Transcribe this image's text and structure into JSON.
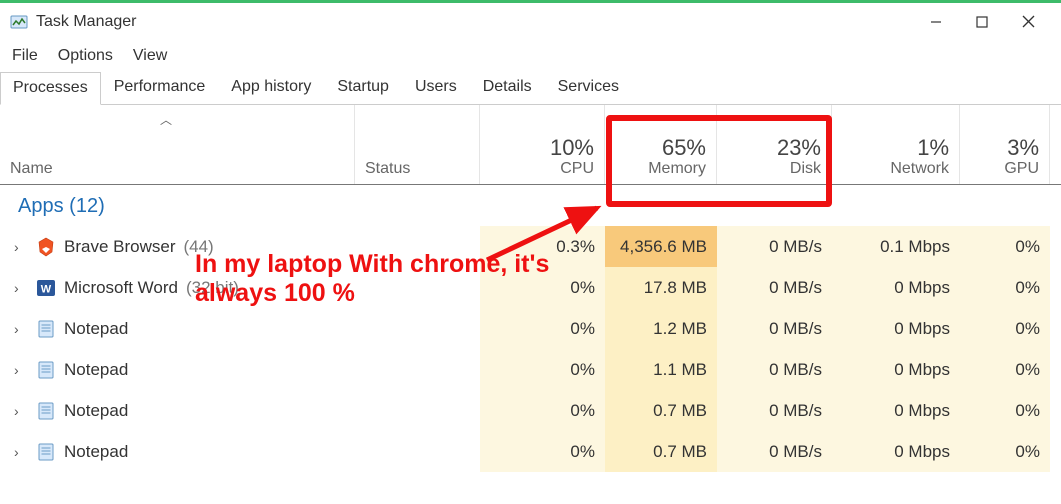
{
  "window": {
    "title": "Task Manager"
  },
  "menu": [
    "File",
    "Options",
    "View"
  ],
  "tabs": [
    "Processes",
    "Performance",
    "App history",
    "Startup",
    "Users",
    "Details",
    "Services"
  ],
  "active_tab_index": 0,
  "columns": {
    "name": "Name",
    "status": "Status",
    "nums": [
      {
        "value": "10%",
        "label": "CPU"
      },
      {
        "value": "65%",
        "label": "Memory"
      },
      {
        "value": "23%",
        "label": "Disk"
      },
      {
        "value": "1%",
        "label": "Network"
      },
      {
        "value": "3%",
        "label": "GPU"
      }
    ]
  },
  "section": {
    "title": "Apps",
    "count": "(12)"
  },
  "rows": [
    {
      "name": "Brave Browser",
      "suffix": "(44)",
      "icon": "brave-icon",
      "cpu": "0.3%",
      "mem": "4,356.6 MB",
      "mem_hot": true,
      "disk": "0 MB/s",
      "net": "0.1 Mbps",
      "gpu": "0%"
    },
    {
      "name": "Microsoft Word",
      "suffix": "(32 bit)",
      "icon": "word-icon",
      "cpu": "0%",
      "mem": "17.8 MB",
      "mem_hot": false,
      "disk": "0 MB/s",
      "net": "0 Mbps",
      "gpu": "0%"
    },
    {
      "name": "Notepad",
      "suffix": "",
      "icon": "notepad-icon",
      "cpu": "0%",
      "mem": "1.2 MB",
      "mem_hot": false,
      "disk": "0 MB/s",
      "net": "0 Mbps",
      "gpu": "0%"
    },
    {
      "name": "Notepad",
      "suffix": "",
      "icon": "notepad-icon",
      "cpu": "0%",
      "mem": "1.1 MB",
      "mem_hot": false,
      "disk": "0 MB/s",
      "net": "0 Mbps",
      "gpu": "0%"
    },
    {
      "name": "Notepad",
      "suffix": "",
      "icon": "notepad-icon",
      "cpu": "0%",
      "mem": "0.7 MB",
      "mem_hot": false,
      "disk": "0 MB/s",
      "net": "0 Mbps",
      "gpu": "0%"
    },
    {
      "name": "Notepad",
      "suffix": "",
      "icon": "notepad-icon",
      "cpu": "0%",
      "mem": "0.7 MB",
      "mem_hot": false,
      "disk": "0 MB/s",
      "net": "0 Mbps",
      "gpu": "0%"
    }
  ],
  "annotation": {
    "line1": "In my laptop With chrome, it's",
    "line2": "always 100 %"
  }
}
